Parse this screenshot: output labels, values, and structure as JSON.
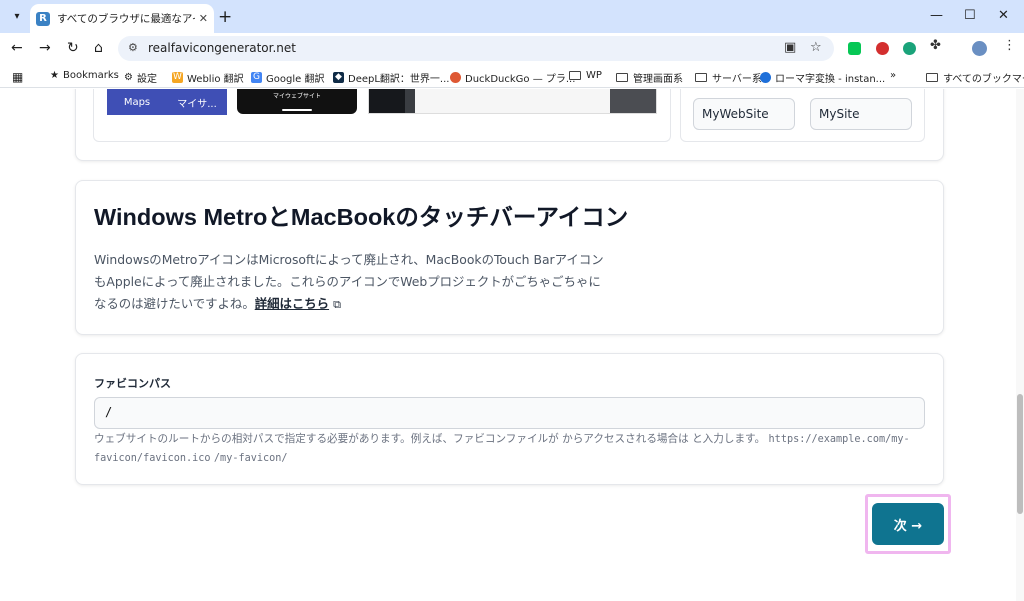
{
  "browser": {
    "tab_title": "すべてのブラウザに最適なアイコンを生成",
    "tab_favicon_letter": "R",
    "new_tab": "+",
    "close_tab": "✕",
    "url": "realfavicongenerator.net",
    "window": {
      "minimize": "—",
      "maximize": "☐",
      "close": "✕"
    }
  },
  "bookmarks": [
    {
      "label": "Bookmarks"
    },
    {
      "label": "設定"
    },
    {
      "label": "Weblio 翻訳"
    },
    {
      "label": "Google 翻訳"
    },
    {
      "label": "DeepL翻訳：世界一..."
    },
    {
      "label": "DuckDuckGo — プラ..."
    },
    {
      "label": "WP"
    },
    {
      "label": "管理画面系"
    },
    {
      "label": "サーバー系"
    },
    {
      "label": "ローマ字変換 - instan..."
    },
    {
      "label": "すべてのブックマーク"
    }
  ],
  "preview": {
    "maps_label": "Maps",
    "my_site_label": "マイサ...",
    "phone_label": "マイウェブサイト",
    "name_field_1": "MyWebSite",
    "name_field_2": "MySite"
  },
  "metro_section": {
    "title": "Windows MetroとMacBookのタッチバーアイコン",
    "description": "WindowsのMetroアイコンはMicrosoftによって廃止され、MacBookのTouch BarアイコンもAppleによって廃止されました。これらのアイコンでWebプロジェクトがごちゃごちゃになるのは避けたいですよね。",
    "more_link": "詳細はこちら"
  },
  "favicon_path": {
    "label": "ファビコンパス",
    "value": "/",
    "help_text": "ウェブサイトのルートからの相対パスで指定する必要があります。例えば、ファビコンファイルが からアクセスされる場合は と入力します。",
    "example_url": "https://example.com/my-favicon/favicon.ico",
    "example_path": "/my-favicon/"
  },
  "next_button": {
    "label": "次 →"
  },
  "colors": {
    "accent": "#0f7490",
    "highlight": "#f0b6ef",
    "tabbar": "#d3e3fd"
  }
}
